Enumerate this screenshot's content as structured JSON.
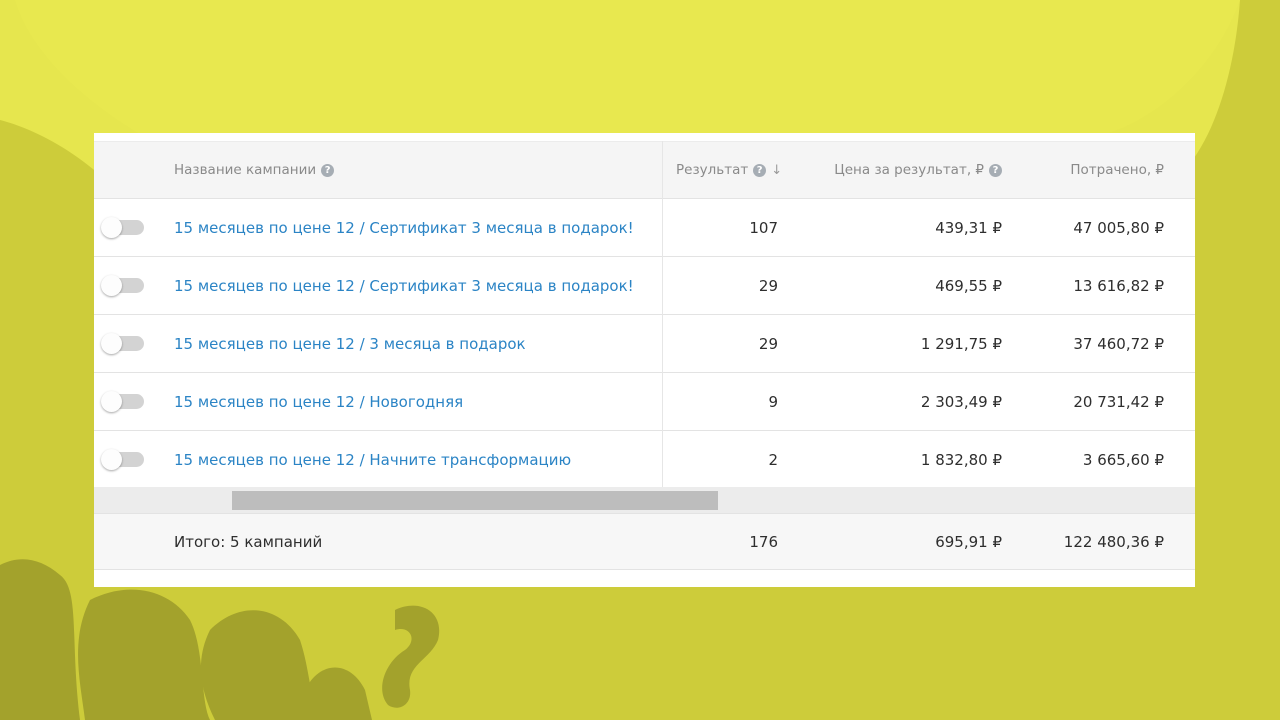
{
  "theme": {
    "background": "#cdcc3a",
    "background_light": "#e6e64e",
    "link_color": "#2b84c5",
    "toggle_off": "#d3d3d3"
  },
  "table": {
    "headers": {
      "name": "Название кампании",
      "result": "Результат",
      "price": "Цена за результат, ₽",
      "spent": "Потрачено, ₽"
    },
    "sort_indicator": "↓",
    "help_icon": "?",
    "rows": [
      {
        "name": "15 месяцев по цене 12 / Сертификат 3 месяца в подарок!",
        "result": "107",
        "price": "439,31 ₽",
        "spent": "47 005,80 ₽",
        "enabled": false
      },
      {
        "name": "15 месяцев по цене 12 / Сертификат 3 месяца в подарок!",
        "result": "29",
        "price": "469,55 ₽",
        "spent": "13 616,82 ₽",
        "enabled": false
      },
      {
        "name": "15 месяцев по цене 12 / 3 месяца в подарок",
        "result": "29",
        "price": "1 291,75 ₽",
        "spent": "37 460,72 ₽",
        "enabled": false
      },
      {
        "name": "15 месяцев по цене 12 / Новогодняя",
        "result": "9",
        "price": "2 303,49 ₽",
        "spent": "20 731,42 ₽",
        "enabled": false
      },
      {
        "name": "15 месяцев по цене 12 / Начните трансформацию",
        "result": "2",
        "price": "1 832,80 ₽",
        "spent": "3 665,60 ₽",
        "enabled": false
      }
    ],
    "total": {
      "label": "Итого: 5 кампаний",
      "result": "176",
      "price": "695,91 ₽",
      "spent": "122 480,36 ₽"
    }
  }
}
